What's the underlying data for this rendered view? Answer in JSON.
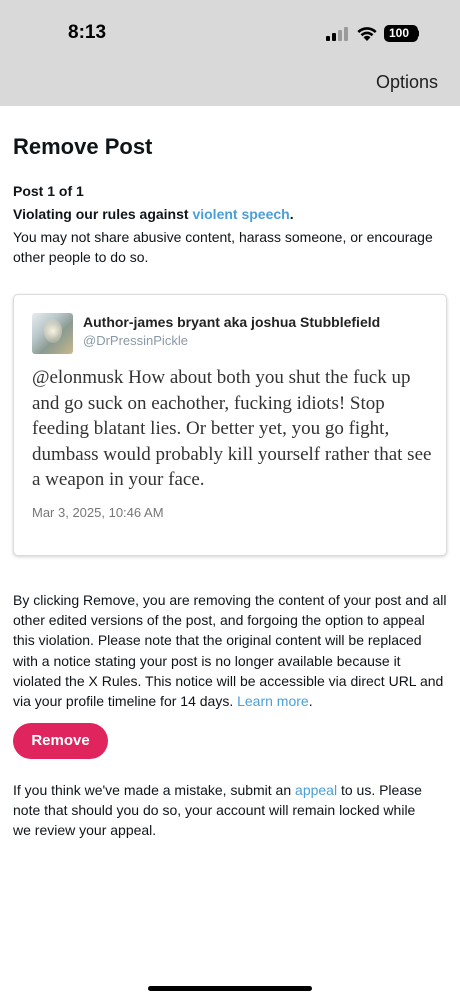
{
  "status_bar": {
    "time": "8:13",
    "battery": "100"
  },
  "nav": {
    "options_label": "Options"
  },
  "page": {
    "title": "Remove Post",
    "post_count": "Post 1 of 1",
    "rule_prefix": "Violating our rules against ",
    "rule_link": "violent speech",
    "rule_suffix": ".",
    "rule_description": "You may not share abusive content, harass someone, or encourage other people to do so."
  },
  "post": {
    "author_name": "Author-james bryant aka joshua Stubblefield",
    "author_handle": "@DrPressinPickle",
    "text": "@elonmusk How about both you shut the fuck up and go suck on eachother, fucking idiots! Stop feeding blatant lies. Or better yet, you go fight, dumbass would probably kill yourself rather that see a weapon in your face.",
    "date": "Mar 3, 2025, 10:46 AM"
  },
  "removal": {
    "description": "By clicking Remove, you are removing the content of your post and all other edited versions of the post, and forgoing the option to appeal this violation. Please note that the original content will be replaced with a notice stating your post is no longer available because it violated the X Rules. This notice will be accessible via direct URL and via your profile timeline for 14 days. ",
    "learn_more": "Learn more",
    "learn_more_suffix": ".",
    "button_label": "Remove"
  },
  "appeal": {
    "prefix": "If you think we've made a mistake, submit an ",
    "link": "appeal",
    "suffix": " to us. Please note that should you do so, your account will remain locked while we review your appeal."
  },
  "colors": {
    "accent_link": "#4a9fd8",
    "remove_button": "#e0245e",
    "header_bg": "#d9d9d9"
  },
  "icons": [
    "cellular-signal-icon",
    "wifi-icon",
    "battery-icon"
  ]
}
